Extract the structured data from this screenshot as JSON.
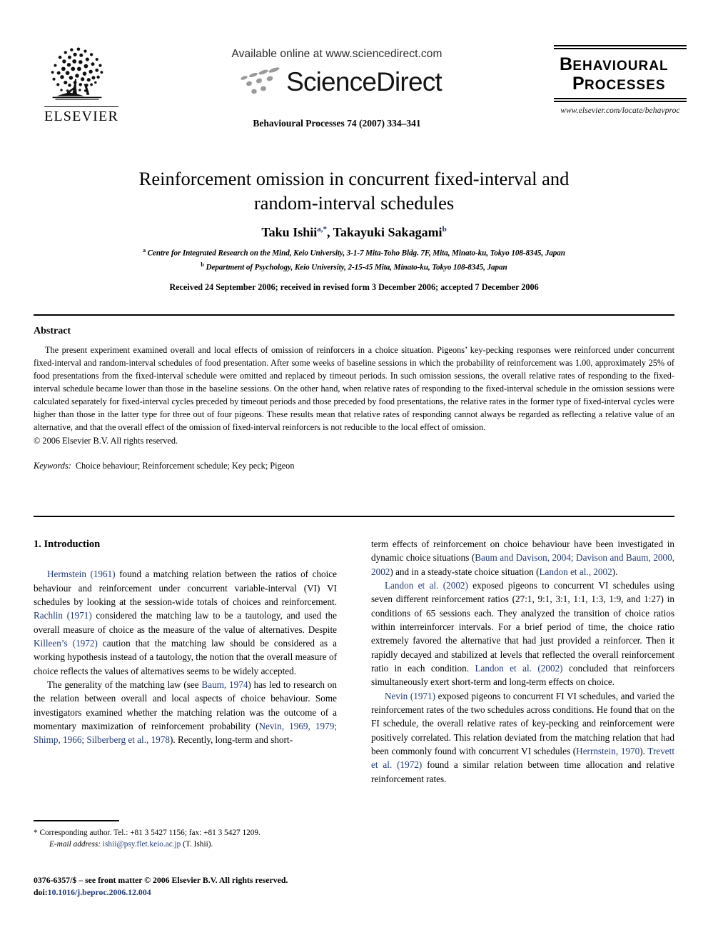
{
  "masthead": {
    "publisher_name": "ELSEVIER",
    "publisher_logo_icon": "elsevier-tree-icon",
    "available_online": "Available online at www.sciencedirect.com",
    "sciencedirect_wordmark": "ScienceDirect",
    "sciencedirect_swoosh_icon": "sciencedirect-swoosh-icon",
    "journal_reference": "Behavioural Processes 74 (2007) 334–341",
    "brand": {
      "line1_cap": "B",
      "line1_rest": "EHAVIOURAL",
      "line2_cap": "P",
      "line2_rest": "ROCESSES",
      "url": "www.elsevier.com/locate/behavproc"
    }
  },
  "article": {
    "title_line1": "Reinforcement omission in concurrent fixed-interval and",
    "title_line2": "random-interval schedules",
    "authors": [
      {
        "name": "Taku Ishii",
        "marks": "a,*"
      },
      {
        "name": "Takayuki Sakagami",
        "marks": "b"
      }
    ],
    "authors_separator": ", ",
    "affiliations": [
      {
        "mark": "a",
        "text": "Centre for Integrated Research on the Mind, Keio University, 3-1-7 Mita-Toho Bldg. 7F, Mita, Minato-ku, Tokyo 108-8345, Japan"
      },
      {
        "mark": "b",
        "text": "Department of Psychology, Keio University, 2-15-45 Mita, Minato-ku, Tokyo 108-8345, Japan"
      }
    ],
    "history": "Received 24 September 2006; received in revised form 3 December 2006; accepted 7 December 2006"
  },
  "abstract": {
    "heading": "Abstract",
    "body": "The present experiment examined overall and local effects of omission of reinforcers in a choice situation. Pigeons’ key-pecking responses were reinforced under concurrent fixed-interval and random-interval schedules of food presentation. After some weeks of baseline sessions in which the probability of reinforcement was 1.00, approximately 25% of food presentations from the fixed-interval schedule were omitted and replaced by timeout periods. In such omission sessions, the overall relative rates of responding to the fixed-interval schedule became lower than those in the baseline sessions. On the other hand, when relative rates of responding to the fixed-interval schedule in the omission sessions were calculated separately for fixed-interval cycles preceded by timeout periods and those preceded by food presentations, the relative rates in the former type of fixed-interval cycles were higher than those in the latter type for three out of four pigeons. These results mean that relative rates of responding cannot always be regarded as reflecting a relative value of an alternative, and that the overall effect of the omission of fixed-interval reinforcers is not reducible to the local effect of omission.",
    "copyright": "© 2006 Elsevier B.V. All rights reserved.",
    "keywords_label": "Keywords:",
    "keywords": "Choice behaviour; Reinforcement schedule; Key peck; Pigeon"
  },
  "body": {
    "section_heading": "1. Introduction",
    "left_column_paragraphs": [
      "Hermstein (1961) found a matching relation between the ratios of choice behaviour and reinforcement under concurrent variable-interval (VI) VI schedules by looking at the session-wide totals of choices and reinforcement. Rachlin (1971) considered the matching law to be a tautology, and used the overall measure of choice as the measure of the value of alternatives. Despite Killeen’s (1972) caution that the matching law should be considered as a working hypothesis instead of a tautology, the notion that the overall measure of choice reflects the values of alternatives seems to be widely accepted.",
      "The generality of the matching law (see Baum, 1974) has led to research on the relation between overall and local aspects of choice behaviour. Some investigators examined whether the matching relation was the outcome of a momentary maximization of reinforcement probability (Nevin, 1969, 1979; Shimp, 1966; Silberberg et al., 1978). Recently, long-term and short-"
    ],
    "right_column_paragraphs": [
      "term effects of reinforcement on choice behaviour have been investigated in dynamic choice situations (Baum and Davison, 2004; Davison and Baum, 2000, 2002) and in a steady-state choice situation (Landon et al., 2002).",
      "Landon et al. (2002) exposed pigeons to concurrent VI schedules using seven different reinforcement ratios (27:1, 9:1, 3:1, 1:1, 1:3, 1:9, and 1:27) in conditions of 65 sessions each. They analyzed the transition of choice ratios within interreinforcer intervals. For a brief period of time, the choice ratio extremely favored the alternative that had just provided a reinforcer. Then it rapidly decayed and stabilized at levels that reflected the overall reinforcement ratio in each condition. Landon et al. (2002) concluded that reinforcers simultaneously exert short-term and long-term effects on choice.",
      "Nevin (1971) exposed pigeons to concurrent FI VI schedules, and varied the reinforcement rates of the two schedules across conditions. He found that on the FI schedule, the overall relative rates of key-pecking and reinforcement were positively correlated. This relation deviated from the matching relation that had been commonly found with concurrent VI schedules (Herrnstein, 1970). Trevett et al. (1972) found a similar relation between time allocation and relative reinforcement rates."
    ],
    "citation_phrases": [
      "Hermstein (1961)",
      "Rachlin (1971)",
      "Killeen’s (1972)",
      "Baum, 1974",
      "Nevin, 1969, 1979; Shimp, 1966; Silberberg et al., 1978",
      "Baum and Davison, 2004; Davison and Baum, 2000, 2002",
      "Landon et al., 2002",
      "Landon et al. (2002)",
      "Nevin (1971)",
      "Herrnstein, 1970",
      "Trevett et al. (1972)"
    ]
  },
  "footnotes": {
    "corresponding_marker": "*",
    "corresponding_text": "Corresponding author. Tel.: +81 3 5427 1156; fax: +81 3 5427 1209.",
    "email_label": "E-mail address:",
    "email": "ishii@psy.flet.keio.ac.jp",
    "email_suffix": "(T. Ishii).",
    "issn_line": "0376-6357/$ – see front matter © 2006 Elsevier B.V. All rights reserved.",
    "doi_label": "doi:",
    "doi": "10.1016/j.beproc.2006.12.004"
  },
  "colors": {
    "citation_blue": "#1f3a78",
    "link_blue": "#1f3a78",
    "text_black": "#000000",
    "page_white": "#ffffff"
  }
}
